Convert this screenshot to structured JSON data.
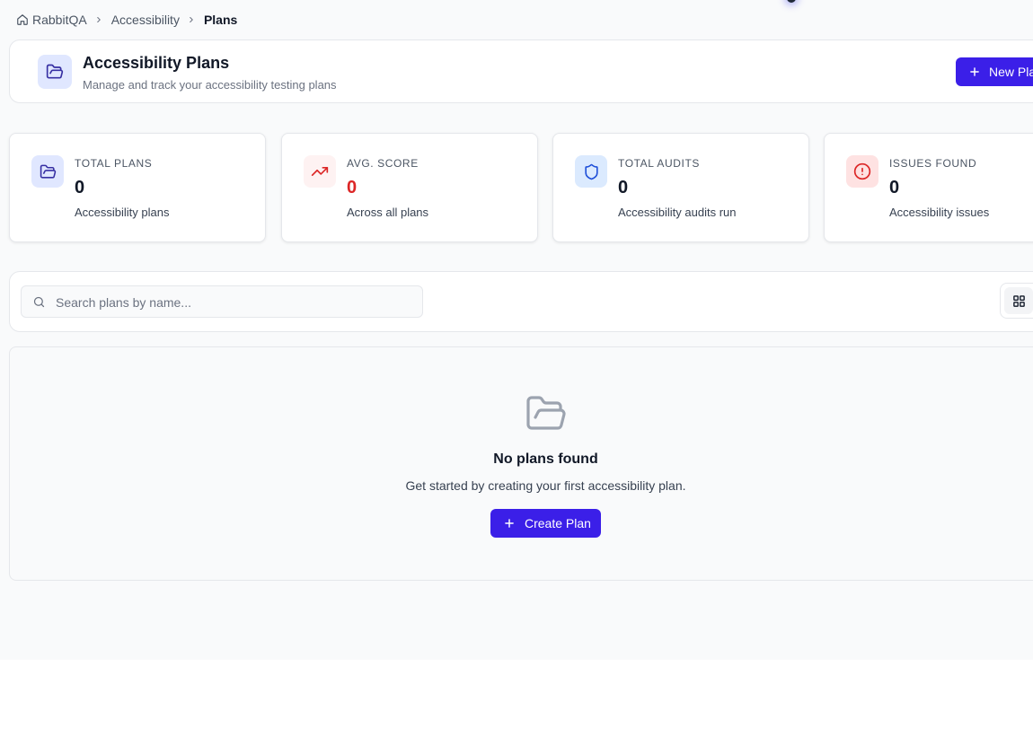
{
  "breadcrumb": {
    "items": [
      {
        "label": "RabbitQA",
        "icon": "home-icon"
      },
      {
        "label": "Accessibility"
      },
      {
        "label": "Plans"
      }
    ]
  },
  "header": {
    "icon": "folder-open-icon",
    "title": "Accessibility Plans",
    "subtitle": "Manage and track your accessibility testing plans",
    "new_plan_label": "New Plan"
  },
  "stats": [
    {
      "label": "Total Plans",
      "value": "0",
      "description": "Accessibility plans",
      "icon": "folder-open-icon",
      "icon_color": "#3730a3",
      "icon_bg": "#e0e7ff"
    },
    {
      "label": "Avg. Score",
      "value": "0",
      "description": "Across all plans",
      "icon": "trending-up-icon",
      "icon_color": "#dc2626",
      "icon_bg": "#fef2f2",
      "value_color": "#dc2626"
    },
    {
      "label": "Total Audits",
      "value": "0",
      "description": "Accessibility audits run",
      "icon": "shield-icon",
      "icon_color": "#1d4ed8",
      "icon_bg": "#dbeafe"
    },
    {
      "label": "Issues Found",
      "value": "0",
      "description": "Accessibility issues",
      "icon": "alert-circle-icon",
      "icon_color": "#dc2626",
      "icon_bg": "#fee2e2"
    }
  ],
  "search": {
    "placeholder": "Search plans by name...",
    "value": ""
  },
  "view_toggle": {
    "active": "grid-icon"
  },
  "empty_state": {
    "icon": "folder-open-icon",
    "title": "No plans found",
    "description": "Get started by creating your first accessibility plan.",
    "button_label": "Create Plan"
  },
  "colors": {
    "primary": "#3b1fe8",
    "background": "#f9fafb",
    "border": "#e5e7eb",
    "danger": "#dc2626"
  }
}
